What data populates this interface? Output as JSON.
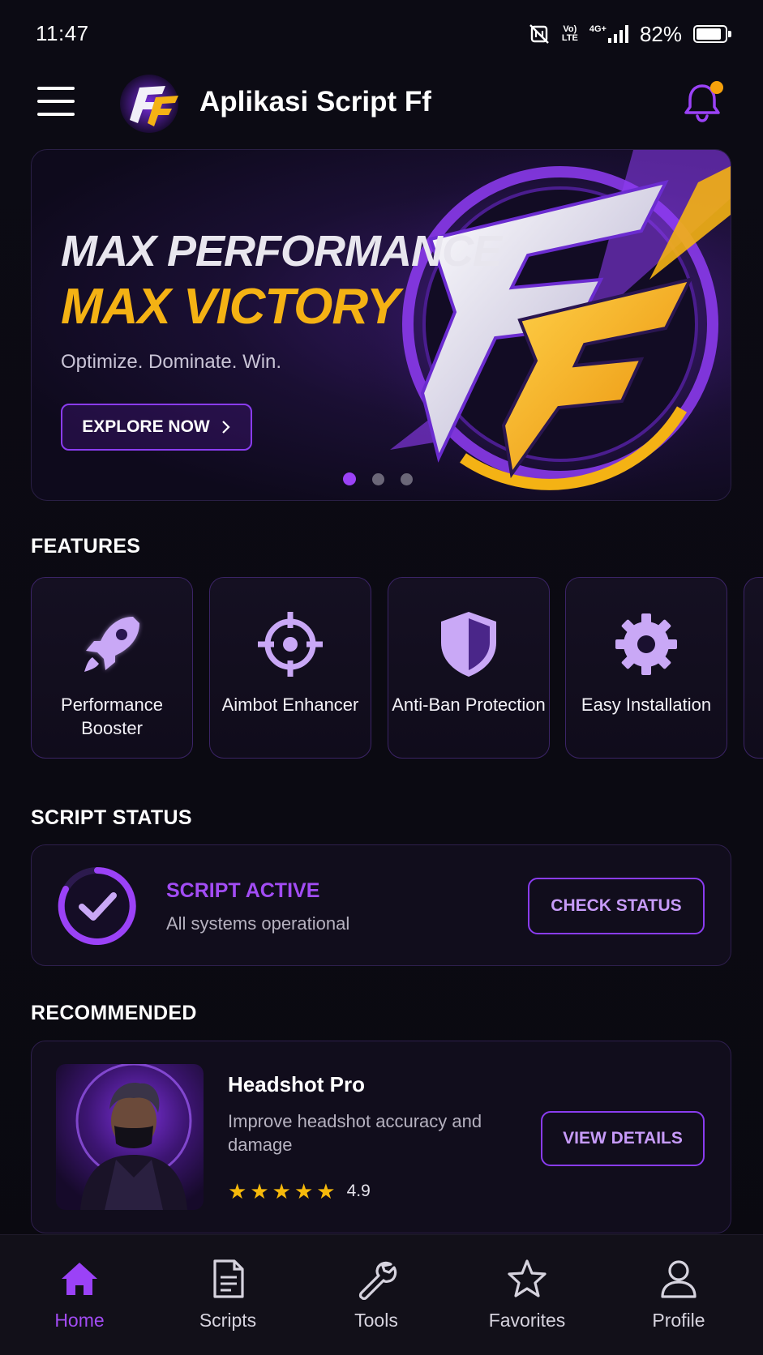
{
  "status_bar": {
    "time": "11:47",
    "network_top": "4G+",
    "volte_top": "Vo)",
    "volte_bottom": "LTE",
    "battery": "82%"
  },
  "app_bar": {
    "title": "Aplikasi Script Ff",
    "menu_icon": "hamburger-menu-icon",
    "notification_icon": "bell-icon",
    "notification_dot_color": "#f6a10b"
  },
  "hero": {
    "line1": "MAX PERFORMANCE",
    "line2": "MAX VICTORY",
    "subtitle": "Optimize. Dominate. Win.",
    "button_label": "EXPLORE NOW",
    "slides_total": 3,
    "active_slide": 1
  },
  "features": {
    "title": "FEATURES",
    "items": [
      {
        "label": "Performance Booster",
        "icon": "rocket-icon"
      },
      {
        "label": "Aimbot Enhancer",
        "icon": "crosshair-icon"
      },
      {
        "label": "Anti-Ban Protection",
        "icon": "shield-icon"
      },
      {
        "label": "Easy Installation",
        "icon": "gear-icon"
      }
    ]
  },
  "script_status": {
    "title": "SCRIPT STATUS",
    "state": "SCRIPT ACTIVE",
    "description": "All systems operational",
    "button_label": "CHECK STATUS"
  },
  "recommended": {
    "title": "RECOMMENDED",
    "item": {
      "name": "Headshot Pro",
      "description": "Improve headshot accuracy and damage",
      "rating": "4.9",
      "stars": 5,
      "button_label": "VIEW DETAILS"
    }
  },
  "bottom_nav": {
    "items": [
      {
        "label": "Home",
        "icon": "home-icon",
        "active": true
      },
      {
        "label": "Scripts",
        "icon": "document-icon",
        "active": false
      },
      {
        "label": "Tools",
        "icon": "wrench-icon",
        "active": false
      },
      {
        "label": "Favorites",
        "icon": "star-icon",
        "active": false
      },
      {
        "label": "Profile",
        "icon": "user-icon",
        "active": false
      }
    ]
  },
  "colors": {
    "accent": "#9b42f7",
    "gold": "#f4b214",
    "background": "#0b0a12"
  }
}
